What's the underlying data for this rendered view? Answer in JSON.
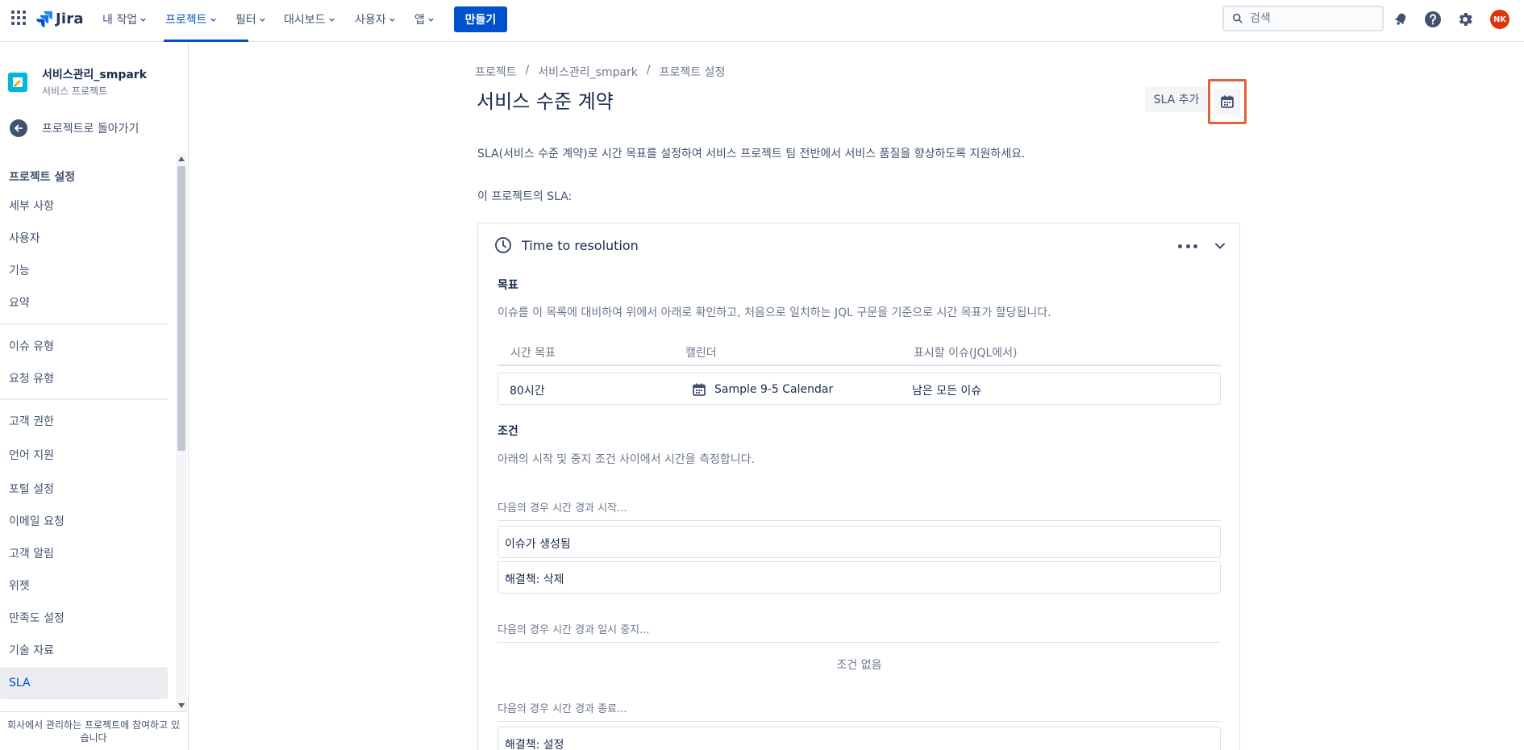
{
  "topnav": {
    "logo_text": "Jira",
    "items": [
      {
        "label": "내 작업"
      },
      {
        "label": "프로젝트"
      },
      {
        "label": "필터"
      },
      {
        "label": "대시보드"
      },
      {
        "label": "사용자"
      },
      {
        "label": "앱"
      }
    ],
    "active_item": "프로젝트",
    "create_label": "만들기",
    "search_placeholder": "검색",
    "avatar_initials": "NK",
    "icons": [
      "apps-grid-icon",
      "notification-bell-icon",
      "help-icon",
      "settings-gear-icon"
    ]
  },
  "sidebar": {
    "project_name": "서비스관리_smpark",
    "project_type": "서비스 프로젝트",
    "back_label": "프로젝트로 돌아가기",
    "section_title": "프로젝트 설정",
    "groups": [
      [
        "세부 사항",
        "사용자",
        "기능",
        "요약"
      ],
      [
        "이슈 유형",
        "요청 유형"
      ],
      [
        "고객 권한",
        "언어 지원",
        "포털 설정",
        "이메일 요청",
        "고객 알림",
        "위젯",
        "만족도 설정",
        "기술 자료",
        "SLA"
      ]
    ],
    "active_item": "SLA",
    "footer_text": "회사에서 관리하는 프로젝트에 참여하고 있습니다"
  },
  "main": {
    "breadcrumb": [
      "프로젝트",
      "서비스관리_smpark",
      "프로젝트 설정"
    ],
    "title": "서비스 수준 계약",
    "add_sla_label": "SLA 추가",
    "description": "SLA(서비스 수준 계약)로 시간 목표를 설정하여 서비스 프로젝트 팀 전반에서 서비스 품질을 향상하도록 지원하세요.",
    "sla_list_label": "이 프로젝트의 SLA:",
    "sla_card": {
      "name": "Time to resolution",
      "goals_title": "목표",
      "goals_description": "이슈를 이 목록에 대비하여 위에서 아래로 확인하고, 처음으로 일치하는 JQL 구문을 기준으로 시간 목표가 할당됩니다.",
      "columns": [
        "시간 목표",
        "캘린더",
        "표시할 이슈(JQL에서)"
      ],
      "goals": [
        {
          "time_goal": "80시간",
          "calendar": "Sample 9-5 Calendar",
          "issues": "남은 모든 이슈"
        }
      ],
      "conditions_title": "조건",
      "conditions_description": "아래의 시작 및 중지 조건 사이에서 시간을 측정합니다.",
      "start_label": "다음의 경우 시간 경과 시작...",
      "start_conditions": [
        "이슈가 생성됨",
        "해결책: 삭제"
      ],
      "pause_label": "다음의 경우 시간 경과 일시 중지...",
      "pause_empty": "조건 없음",
      "stop_label": "다음의 경우 시간 경과 종료...",
      "stop_conditions": [
        "해결책: 설정"
      ]
    }
  },
  "colors": {
    "primary": "#0052cc",
    "highlight_border": "#e0623d",
    "avatar_bg": "#de350b",
    "project_avatar": "#00b8d9"
  }
}
